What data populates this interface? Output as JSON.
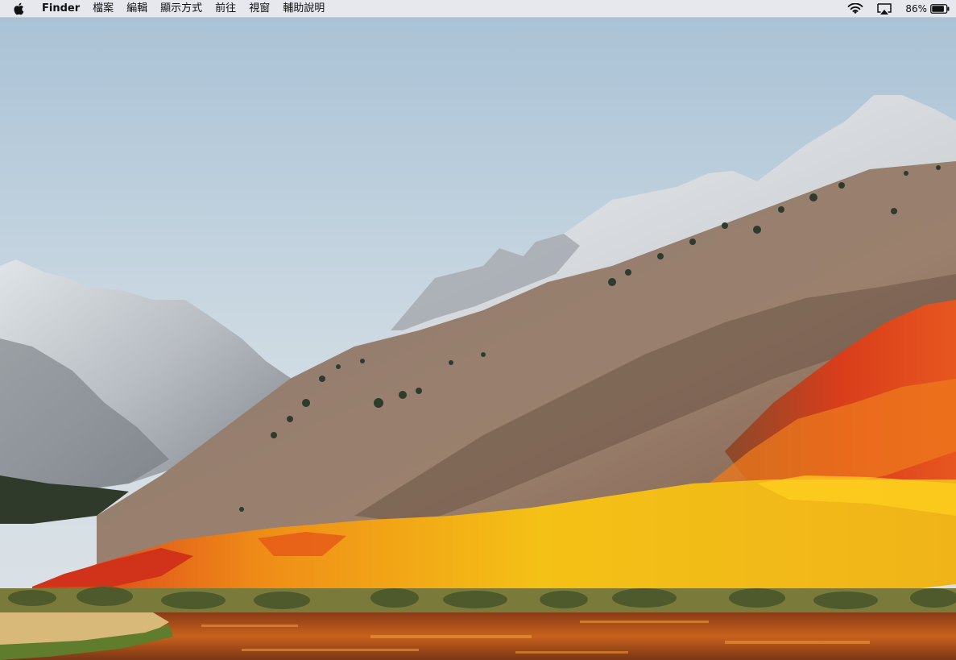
{
  "menubar": {
    "apple_icon": "apple-logo-icon",
    "app_name": "Finder",
    "menus": [
      "檔案",
      "編輯",
      "顯示方式",
      "前往",
      "視窗",
      "輔助說明"
    ],
    "status": {
      "wifi_icon": "wifi-icon",
      "airplay_icon": "airplay-icon",
      "battery_percent": "86%",
      "battery_level": 0.86,
      "battery_icon": "battery-icon"
    }
  },
  "desktop": {
    "wallpaper": "macOS High Sierra wallpaper",
    "colors": {
      "sky_top": "#a9c2d6",
      "sky_bottom": "#d9e1e6",
      "snow": "#e8ecef",
      "rock": "#7b6a63",
      "foliage_yellow": "#f2b21a",
      "foliage_orange": "#e8661c",
      "foliage_red": "#d63a1c",
      "lake": "#b8581b"
    }
  }
}
